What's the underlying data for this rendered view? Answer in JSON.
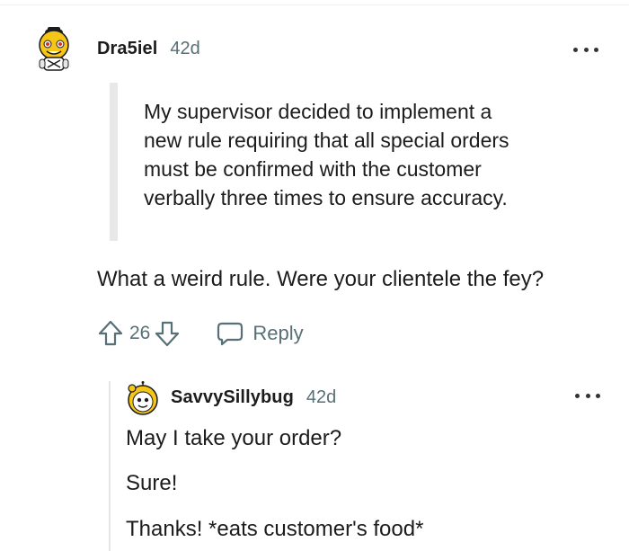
{
  "comment": {
    "author": "Dra5iel",
    "age": "42d",
    "quote": "My supervisor decided to implement a\nnew rule requiring that all special orders\nmust be confirmed with the customer\nverbally three times to ensure accuracy.",
    "body": "What a weird rule. Were your clientele the fey?",
    "score": "26",
    "reply_label": "Reply",
    "icons": {
      "upvote": "arrow-up-outline-icon",
      "downvote": "arrow-down-outline-icon",
      "reply": "speech-bubble-icon",
      "more": "ellipsis-icon"
    }
  },
  "reply": {
    "author": "SavvySillybug",
    "age": "42d",
    "lines": [
      "May I take your order?",
      "Sure!",
      "Thanks! *eats customer's food*"
    ]
  },
  "colors": {
    "text": "#1c1c1c",
    "muted": "#576f76",
    "quote_bar": "#e8e8e8",
    "avatar_yellow": "#f5c518"
  }
}
